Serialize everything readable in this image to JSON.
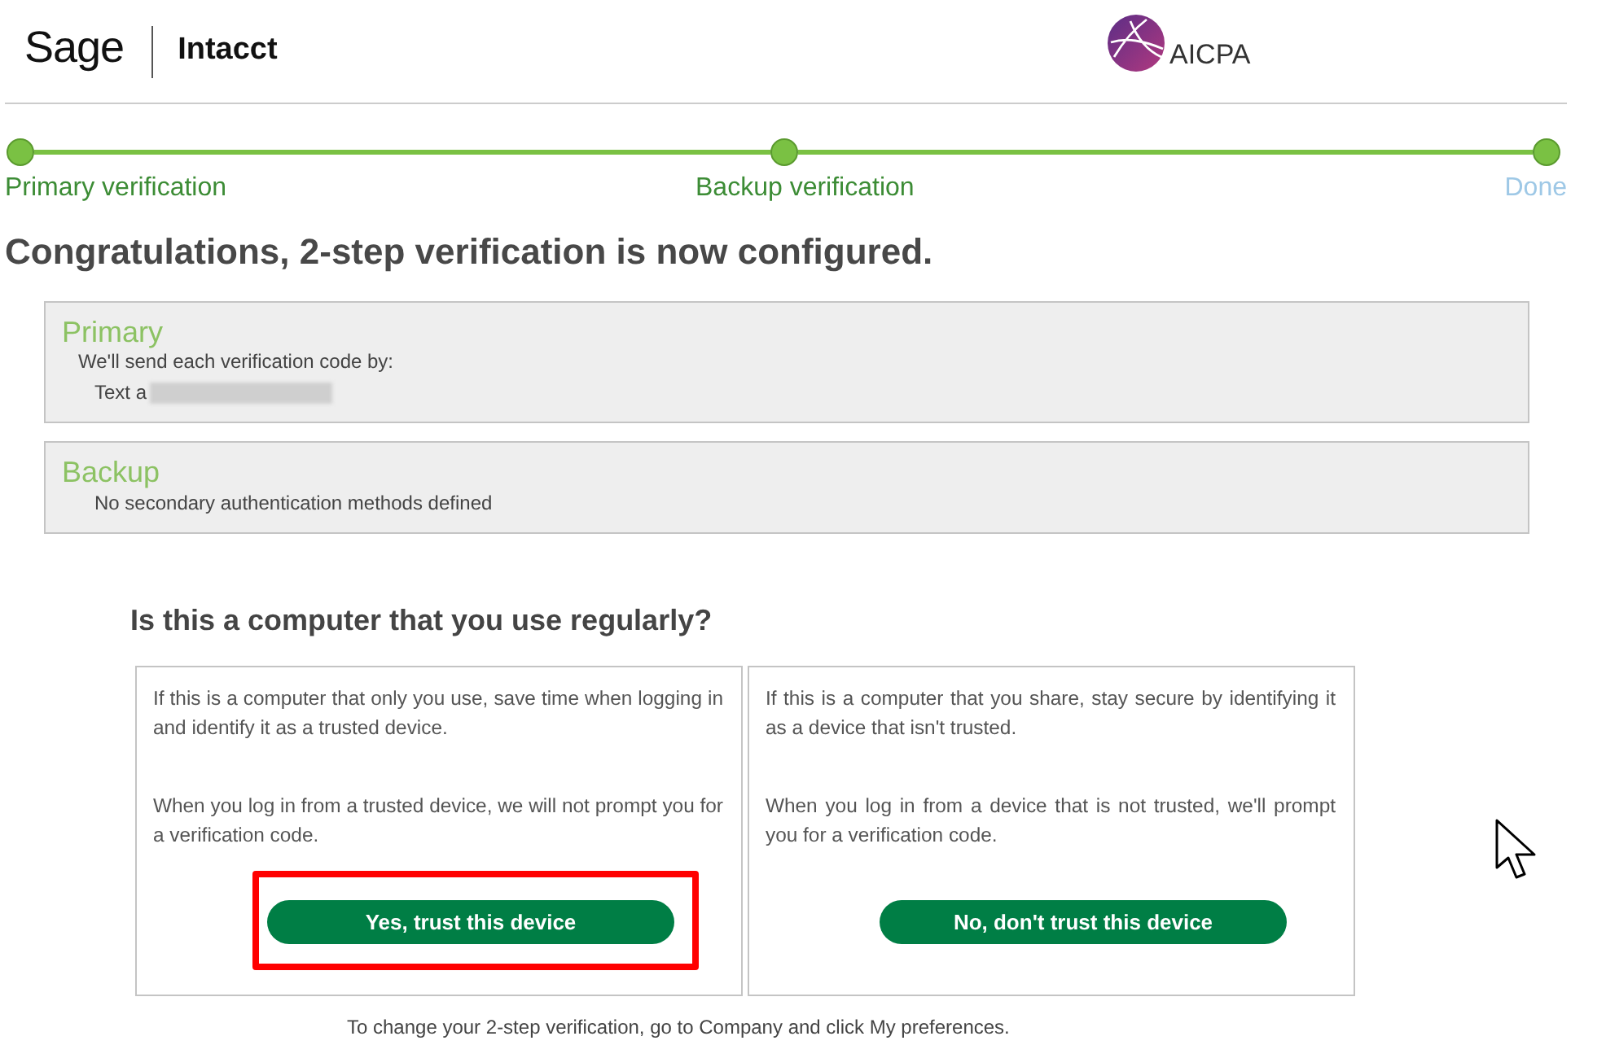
{
  "header": {
    "brand": "Sage",
    "product": "Intacct",
    "partner": "AICPA"
  },
  "steps": [
    {
      "label": "Primary verification",
      "completed": true
    },
    {
      "label": "Backup verification",
      "completed": true
    },
    {
      "label": "Done",
      "completed": false
    }
  ],
  "heading": "Congratulations, 2-step verification is now configured.",
  "methods": [
    {
      "title": "Primary",
      "description": "We'll send each verification code by:",
      "detail": "Text a",
      "redacted": true
    },
    {
      "title": "Backup",
      "detail": "No secondary authentication methods defined",
      "redacted": false
    }
  ],
  "question": "Is this a computer that you use regularly?",
  "options": [
    {
      "paragraphs": [
        "If this is a computer that only you use, save time when logging in and identify it as a trusted device.",
        "When you log in from a trusted device, we will not prompt you for a verification code."
      ],
      "button": "Yes, trust this device",
      "highlighted": true
    },
    {
      "paragraphs": [
        "If this is a computer that you share, stay secure by identifying it as a device that isn't trusted.",
        "When you log in from a device that is not trusted, we'll prompt you for a verification code."
      ],
      "button": "No, don't trust this device",
      "highlighted": false
    }
  ],
  "footer": "To change your 2-step verification, go to Company and click My preferences."
}
